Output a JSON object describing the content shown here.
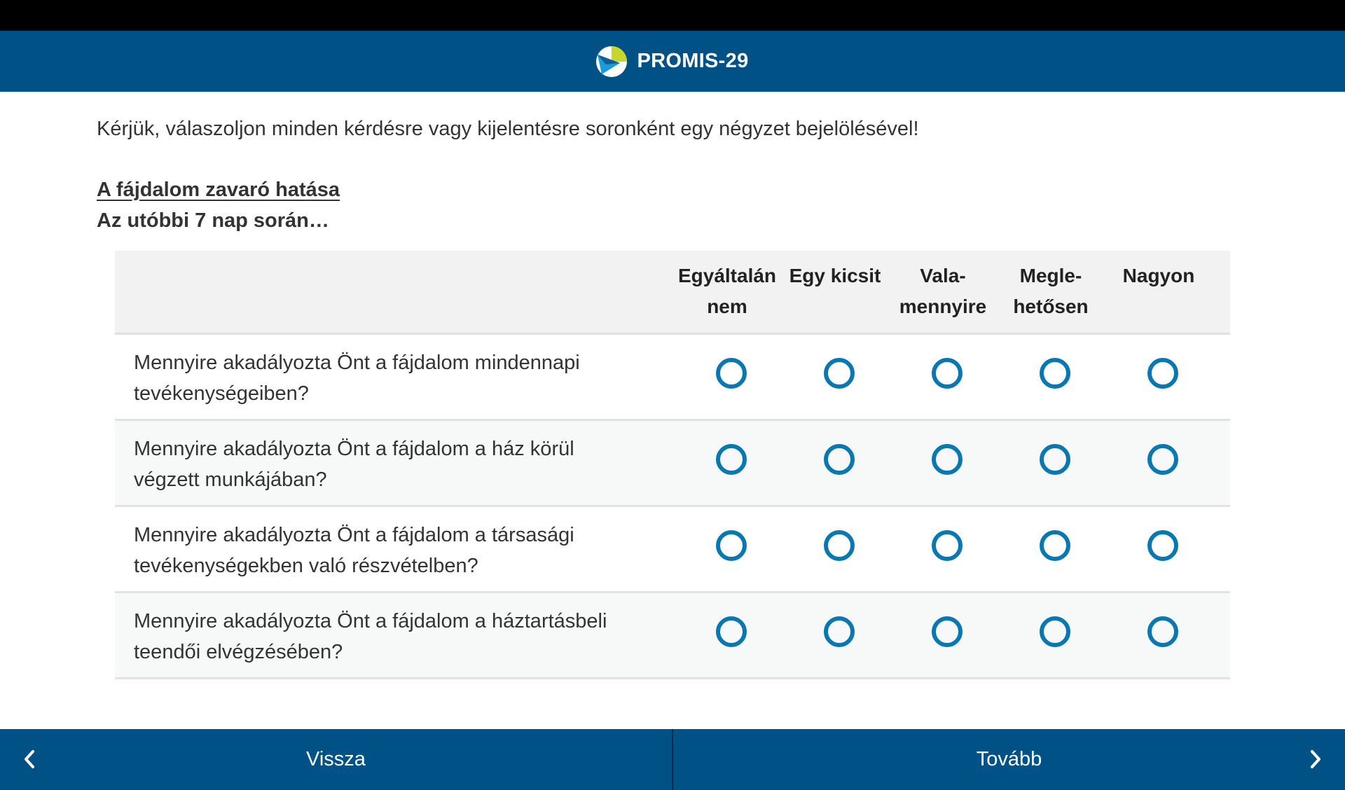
{
  "app": {
    "title": "PROMIS-29"
  },
  "instructions": "Kérjük, válaszoljon minden kérdésre vagy kijelentésre soronként egy négyzet bejelölésével!",
  "section": {
    "title": "A fájdalom zavaró hatása",
    "subtitle": "Az utóbbi 7 nap során…"
  },
  "columns": [
    {
      "line1": "Egyáltalán",
      "line2": "nem"
    },
    {
      "line1": "Egy kicsit",
      "line2": ""
    },
    {
      "line1": "Vala-",
      "line2": "mennyire"
    },
    {
      "line1": "Megle-",
      "line2": "hetősen"
    },
    {
      "line1": "Nagyon",
      "line2": ""
    }
  ],
  "questions": [
    {
      "line1": "Mennyire akadályozta Önt a fájdalom mindennapi",
      "line2": "tevékenységeiben?",
      "selected": null
    },
    {
      "line1": "Mennyire akadályozta Önt a fájdalom a ház körül",
      "line2": "végzett munkájában?",
      "selected": null
    },
    {
      "line1": "Mennyire akadályozta Önt a fájdalom a társasági",
      "line2": "tevékenységekben való részvételben?",
      "selected": null
    },
    {
      "line1": "Mennyire akadályozta Önt a fájdalom a háztartásbeli",
      "line2": "teendői elvégzésében?",
      "selected": null
    }
  ],
  "nav": {
    "back_label": "Vissza",
    "next_label": "Tovább"
  },
  "colors": {
    "primary": "#005186",
    "radio": "#0a78b0",
    "logo_yellow": "#c8d62b",
    "logo_blue": "#1a9ad6"
  }
}
